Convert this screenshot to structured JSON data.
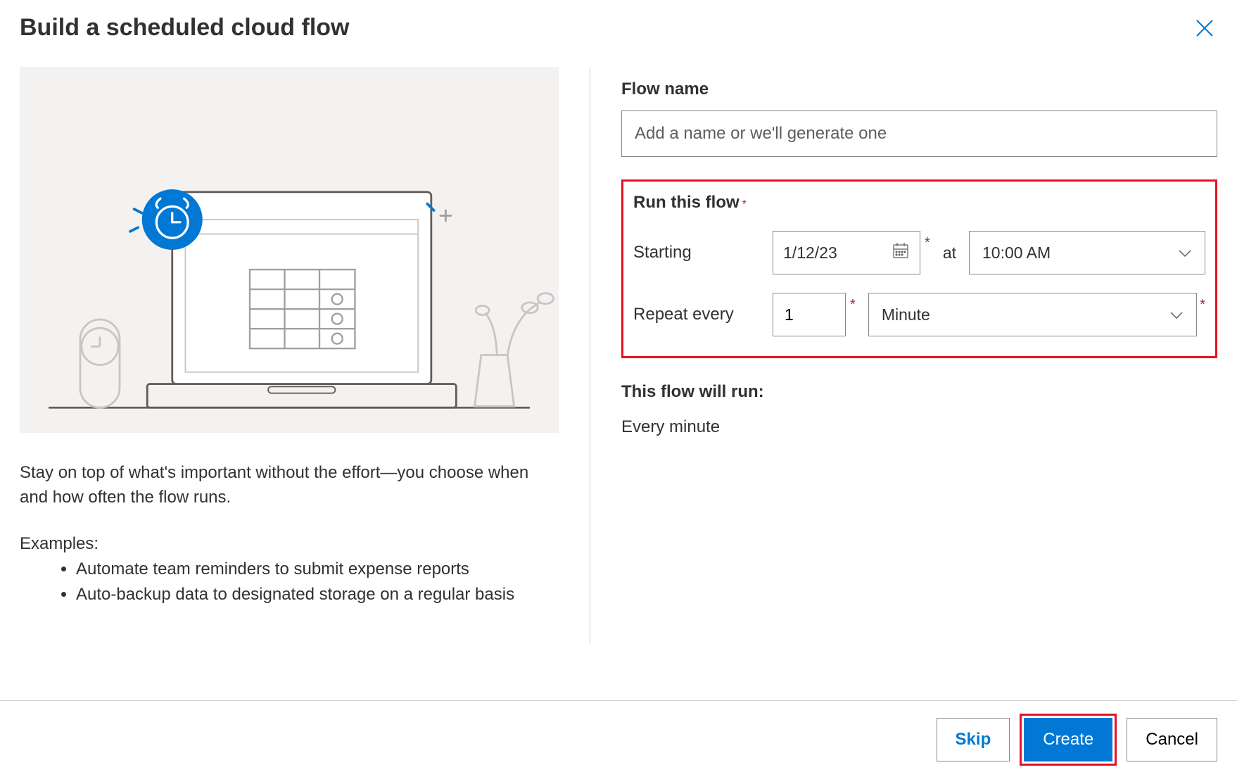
{
  "header": {
    "title": "Build a scheduled cloud flow"
  },
  "left": {
    "description": "Stay on top of what's important without the effort—you choose when and how often the flow runs.",
    "examples_label": "Examples:",
    "examples": [
      "Automate team reminders to submit expense reports",
      "Auto-backup data to designated storage on a regular basis"
    ]
  },
  "form": {
    "flow_name_label": "Flow name",
    "flow_name_placeholder": "Add a name or we'll generate one",
    "flow_name_value": "",
    "run_section_label": "Run this flow",
    "starting_label": "Starting",
    "starting_date": "1/12/23",
    "at_label": "at",
    "starting_time": "10:00 AM",
    "repeat_label": "Repeat every",
    "repeat_count": "1",
    "repeat_unit": "Minute",
    "summary_label": "This flow will run:",
    "summary_text": "Every minute"
  },
  "footer": {
    "skip_label": "Skip",
    "create_label": "Create",
    "cancel_label": "Cancel"
  }
}
